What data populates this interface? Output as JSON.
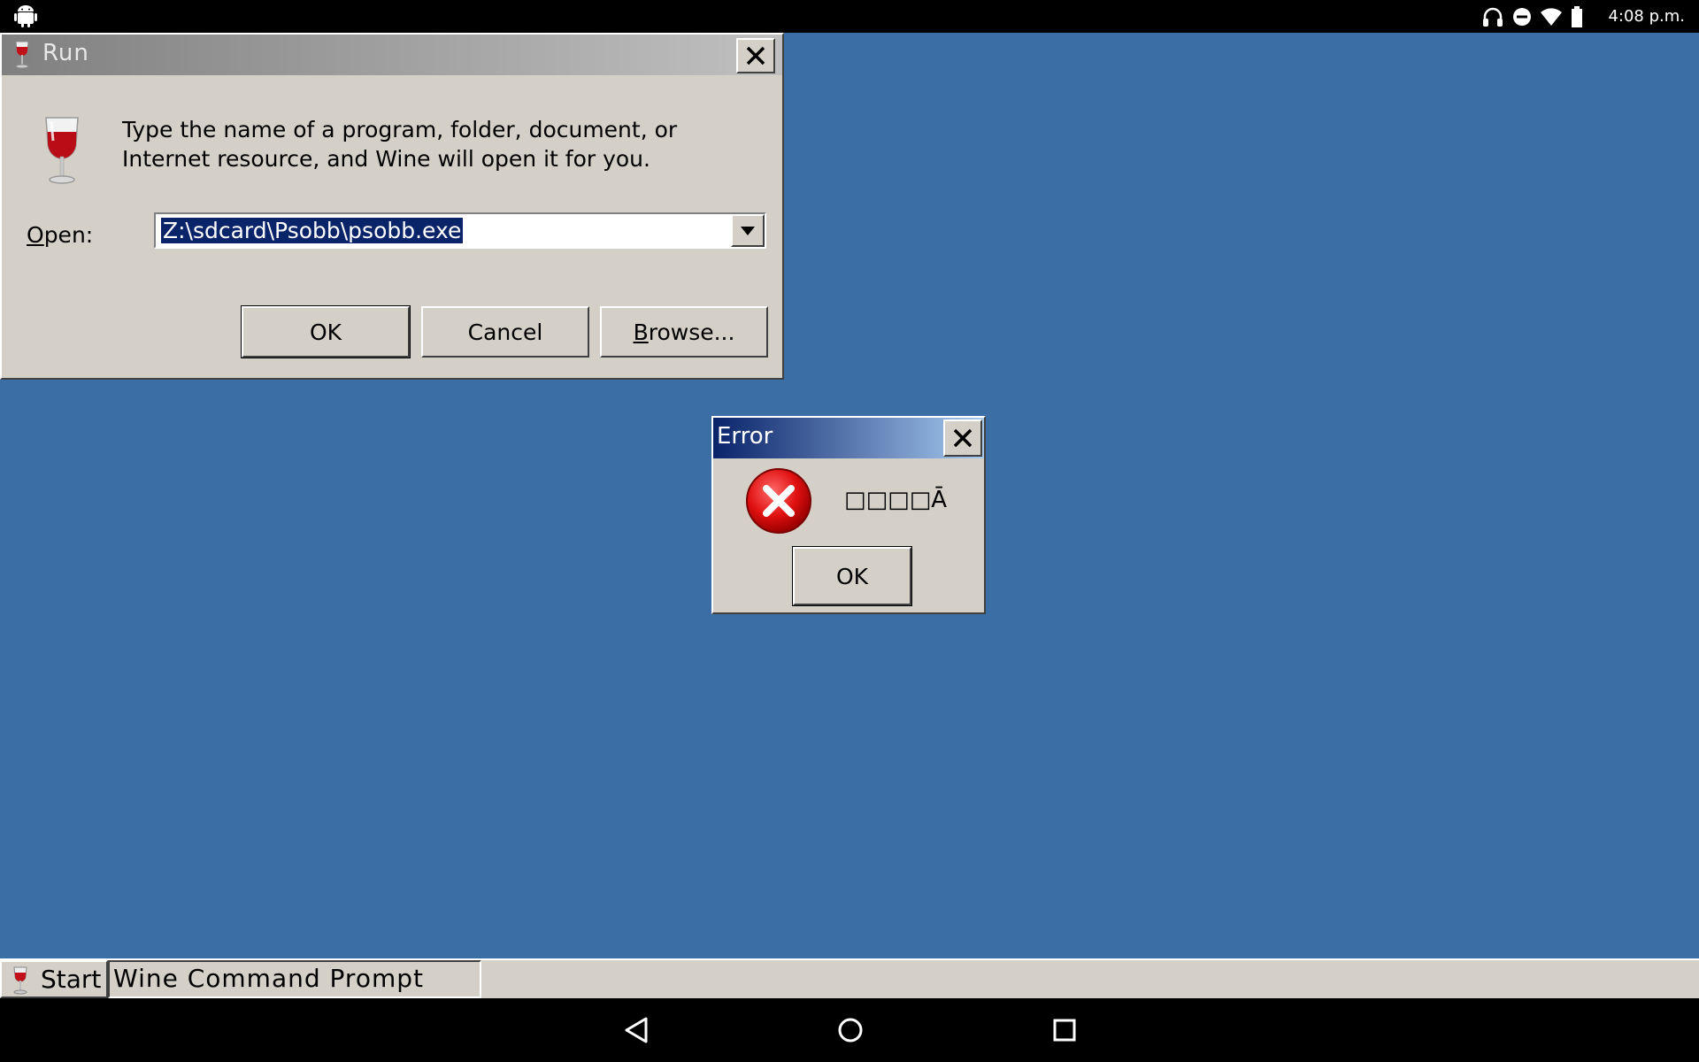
{
  "status_bar": {
    "time": "4:08 p.m.",
    "icons": [
      "android-logo",
      "headphones-icon",
      "do-not-disturb-icon",
      "wifi-icon",
      "battery-icon"
    ]
  },
  "run_dialog": {
    "title": "Run",
    "description": "Type the name of a program, folder, document, or Internet resource, and Wine will open it for you.",
    "open_label": "Open:",
    "open_value": "Z:\\sdcard\\Psobb\\psobb.exe",
    "buttons": {
      "ok": "OK",
      "cancel": "Cancel",
      "browse": "Browse..."
    },
    "title_gradient": [
      "#808080",
      "#c0c0c0"
    ]
  },
  "error_dialog": {
    "title": "Error",
    "message": "□□□□Ā",
    "ok": "OK",
    "icon": "error-x-icon",
    "title_gradient": [
      "#0a246a",
      "#a6caf0"
    ]
  },
  "taskbar": {
    "start": "Start",
    "task": "Wine Command Prompt"
  },
  "nav_bar": {
    "icons": [
      "back-icon",
      "home-icon",
      "recents-icon"
    ]
  },
  "colors": {
    "desktop": "#3b6ea5",
    "face": "#d4d0c8",
    "selection": "#0a246a"
  }
}
